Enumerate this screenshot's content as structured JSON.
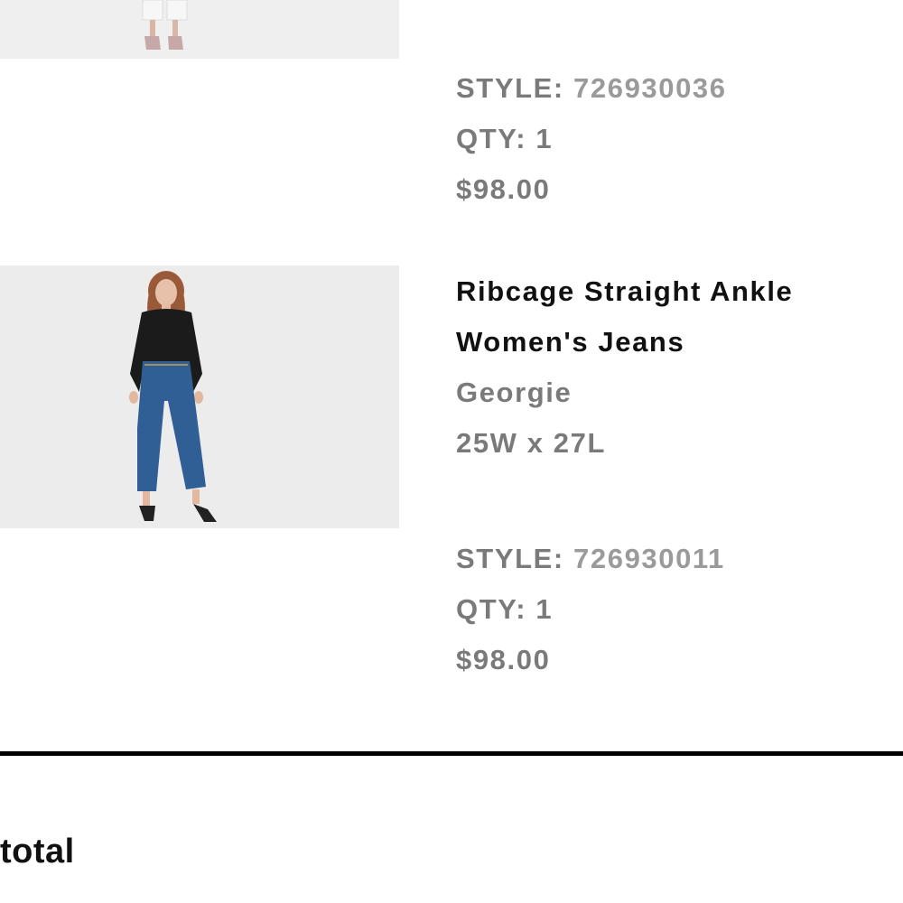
{
  "items": [
    {
      "style_label": "STYLE:",
      "style_value": "726930036",
      "qty": "QTY: 1",
      "price": "$98.00"
    },
    {
      "name_line1": "Ribcage Straight Ankle",
      "name_line2": "Women's Jeans",
      "color": "Georgie",
      "size": "25W x 27L",
      "style_label": "STYLE:",
      "style_value": "726930011",
      "qty": "QTY: 1",
      "price": "$98.00"
    }
  ],
  "summary": {
    "subtotal_label": "total"
  }
}
